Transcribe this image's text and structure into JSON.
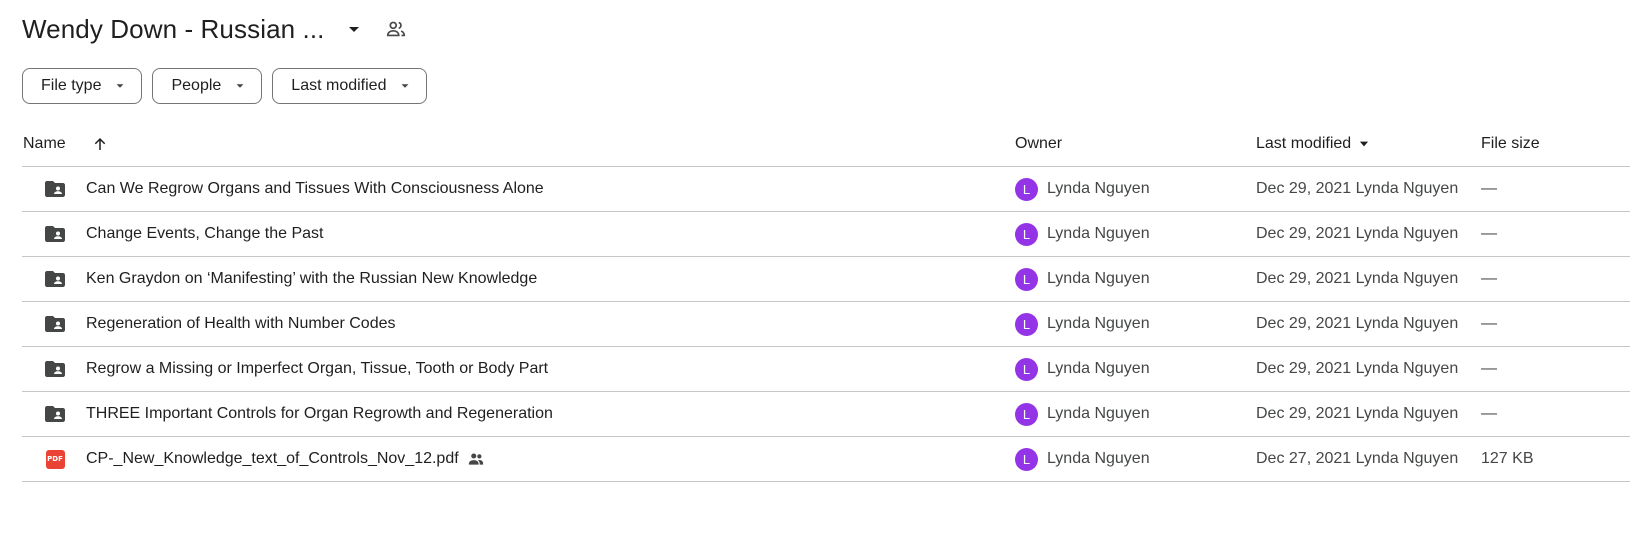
{
  "header": {
    "title": "Wendy Down - Russian ...",
    "caret_icon": "arrow-drop-down-icon",
    "shared_icon": "people-outline-icon"
  },
  "filters": [
    {
      "label": "File type"
    },
    {
      "label": "People"
    },
    {
      "label": "Last modified"
    }
  ],
  "table": {
    "columns": {
      "name": "Name",
      "owner": "Owner",
      "modified": "Last modified",
      "size": "File size"
    },
    "sort": {
      "column": "Last modified",
      "name_arrow": "arrow-upward-icon",
      "direction_icon": "arrow-drop-down-icon"
    },
    "rows": [
      {
        "type": "shared-folder",
        "icon": "shared-folder-icon",
        "name": "Can We Regrow Organs and Tissues With Consciousness Alone",
        "avatar": "L",
        "owner": "Lynda Nguyen",
        "modified": "Dec 29, 2021 Lynda Nguyen",
        "size": "—"
      },
      {
        "type": "shared-folder",
        "icon": "shared-folder-icon",
        "name": "Change Events, Change the Past",
        "avatar": "L",
        "owner": "Lynda Nguyen",
        "modified": "Dec 29, 2021 Lynda Nguyen",
        "size": "—"
      },
      {
        "type": "shared-folder",
        "icon": "shared-folder-icon",
        "name": "Ken Graydon on ‘Manifesting’ with the Russian New Knowledge",
        "avatar": "L",
        "owner": "Lynda Nguyen",
        "modified": "Dec 29, 2021 Lynda Nguyen",
        "size": "—"
      },
      {
        "type": "shared-folder",
        "icon": "shared-folder-icon",
        "name": "Regeneration of Health with Number Codes",
        "avatar": "L",
        "owner": "Lynda Nguyen",
        "modified": "Dec 29, 2021 Lynda Nguyen",
        "size": "—"
      },
      {
        "type": "shared-folder",
        "icon": "shared-folder-icon",
        "name": "Regrow a Missing or Imperfect Organ, Tissue, Tooth or Body Part",
        "avatar": "L",
        "owner": "Lynda Nguyen",
        "modified": "Dec 29, 2021 Lynda Nguyen",
        "size": "—"
      },
      {
        "type": "shared-folder",
        "icon": "shared-folder-icon",
        "name": "THREE Important Controls for Organ Regrowth and Regeneration",
        "avatar": "L",
        "owner": "Lynda Nguyen",
        "modified": "Dec 29, 2021 Lynda Nguyen",
        "size": "—"
      },
      {
        "type": "pdf",
        "icon": "pdf-icon",
        "pdf_label": "PDF",
        "name": "CP-_New_Knowledge_text_of_Controls_Nov_12.pdf",
        "shared": true,
        "avatar": "L",
        "owner": "Lynda Nguyen",
        "modified": "Dec 27, 2021 Lynda Nguyen",
        "size": "127 KB"
      }
    ]
  },
  "colors": {
    "avatar": "#9334e6",
    "folder": "#444746",
    "pdf": "#ea4335",
    "divider": "#c4c7c5"
  }
}
